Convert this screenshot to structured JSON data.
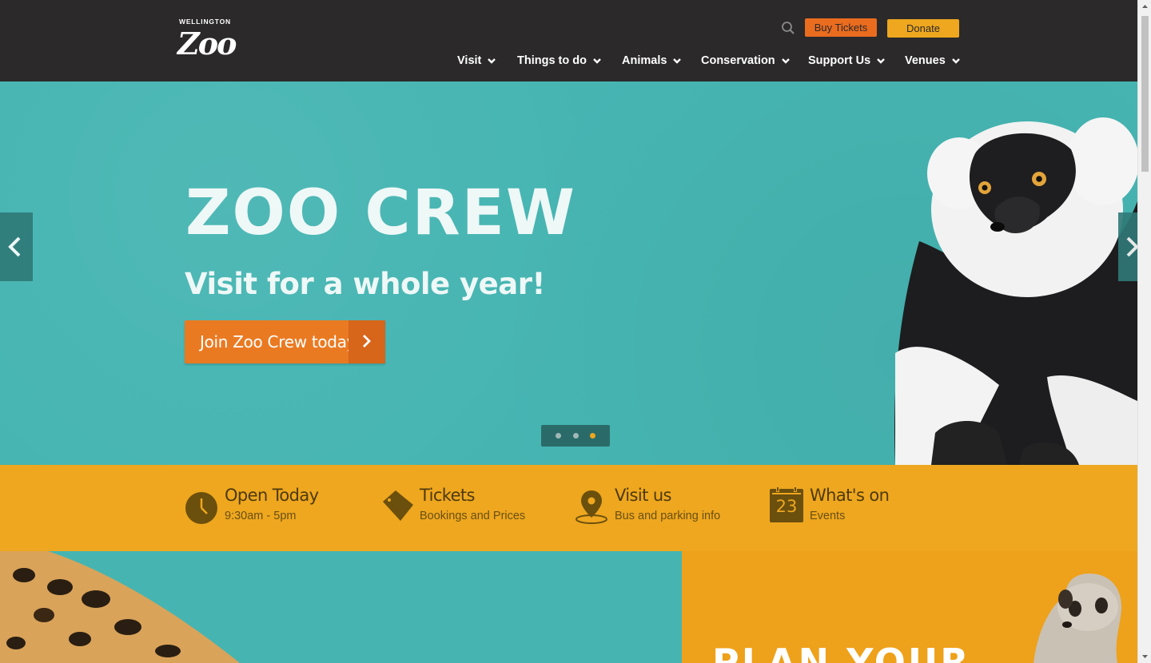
{
  "header": {
    "logo_small": "WELLINGTON",
    "logo_big": "Zoo",
    "search_icon": "search-icon",
    "buy_tickets": "Buy Tickets",
    "donate": "Donate",
    "nav": [
      {
        "label": "Visit"
      },
      {
        "label": "Things to do"
      },
      {
        "label": "Animals"
      },
      {
        "label": "Conservation"
      },
      {
        "label": "Support Us"
      },
      {
        "label": "Venues"
      }
    ]
  },
  "hero": {
    "title": "ZOO CREW",
    "subtitle": "Visit for a whole year!",
    "cta_label": "Join Zoo Crew today",
    "prev_icon": "chevron-left-icon",
    "next_icon": "chevron-right-icon",
    "slides_total": 3,
    "active_slide": 3
  },
  "info": [
    {
      "title": "Open Today",
      "sub": "9:30am - 5pm",
      "icon": "clock-icon"
    },
    {
      "title": "Tickets",
      "sub": "Bookings and Prices",
      "icon": "ticket-icon"
    },
    {
      "title": "Visit us",
      "sub": "Bus and parking info",
      "icon": "map-pin-icon"
    },
    {
      "title": "What's on",
      "sub": "Events",
      "icon": "calendar-icon",
      "calendar_day": "23"
    }
  ],
  "plan": {
    "title": "PLAN YOUR"
  },
  "colors": {
    "header_bg": "#2b292a",
    "hero_bg": "#46b5b2",
    "accent_orange": "#ea6c1f",
    "accent_yellow": "#eea71f",
    "info_text": "#4e3a0c"
  }
}
